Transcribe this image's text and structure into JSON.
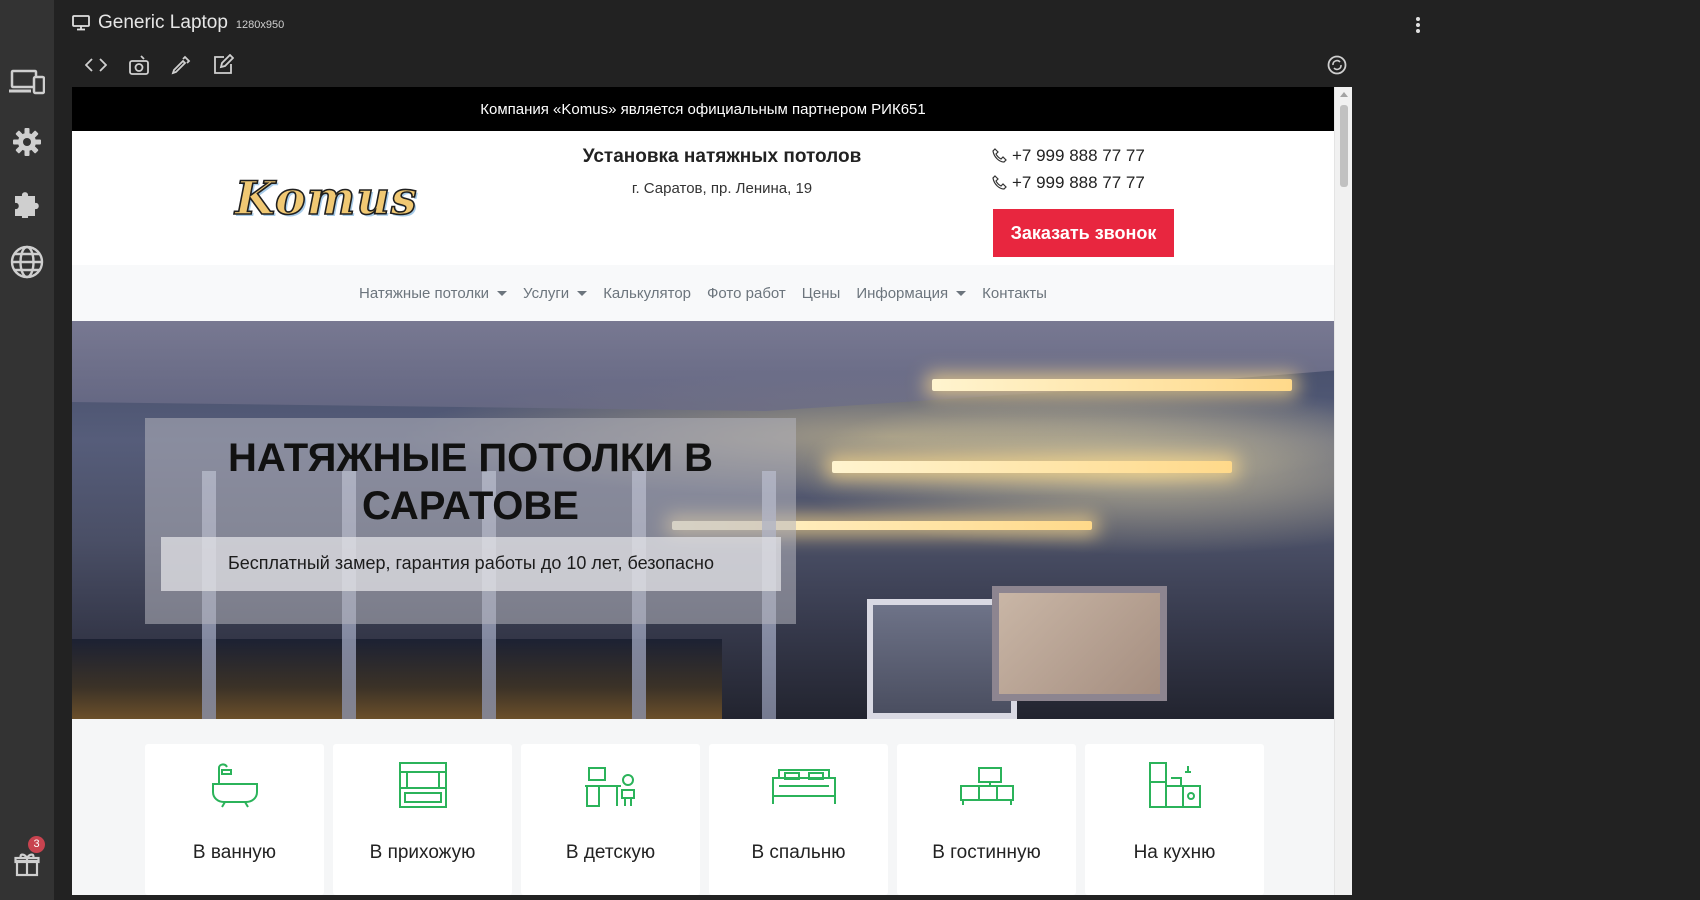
{
  "device": {
    "title": "Generic Laptop",
    "size": "1280x950"
  },
  "sidebar": {
    "items": [
      {
        "icon": "devices-icon"
      },
      {
        "icon": "gear-icon"
      },
      {
        "icon": "puzzle-icon"
      },
      {
        "icon": "globe-icon"
      }
    ],
    "gift": {
      "icon": "gift-icon",
      "badge": "3"
    }
  },
  "toolbar": {
    "tools": [
      "code-icon",
      "screenshot-icon",
      "color-picker-icon",
      "edit-icon"
    ],
    "rotate": "rotate-icon"
  },
  "site": {
    "topbar": "Компания «Komus» является официальным партнером РИК651",
    "logo": "Komus",
    "tagline": "Установка натяжных потолов",
    "address": "г. Саратов, пр. Ленина, 19",
    "phones": [
      "+7 999 888 77 77",
      "+7 999 888 77 77"
    ],
    "callback": "Заказать звонок",
    "nav": [
      {
        "label": "Натяжные потолки",
        "dropdown": true
      },
      {
        "label": "Услуги",
        "dropdown": true
      },
      {
        "label": "Калькулятор",
        "dropdown": false
      },
      {
        "label": "Фото работ",
        "dropdown": false
      },
      {
        "label": "Цены",
        "dropdown": false
      },
      {
        "label": "Информация",
        "dropdown": true
      },
      {
        "label": "Контакты",
        "dropdown": false
      }
    ],
    "hero": {
      "title": "НАТЯЖНЫЕ ПОТОЛКИ В САРАТОВЕ",
      "subtitle": "Бесплатный замер, гарантия работы до 10 лет, безопасно"
    },
    "rooms": [
      {
        "label": "В ванную",
        "icon": "bathtub-icon"
      },
      {
        "label": "В прихожую",
        "icon": "wardrobe-icon"
      },
      {
        "label": "В детскую",
        "icon": "kids-desk-icon"
      },
      {
        "label": "В спальню",
        "icon": "bed-icon"
      },
      {
        "label": "В гостинную",
        "icon": "tv-stand-icon"
      },
      {
        "label": "На кухню",
        "icon": "kitchen-icon"
      }
    ]
  },
  "colors": {
    "accent_red": "#e8263f",
    "icon_green": "#2bb35a",
    "topbar": "#000000"
  }
}
